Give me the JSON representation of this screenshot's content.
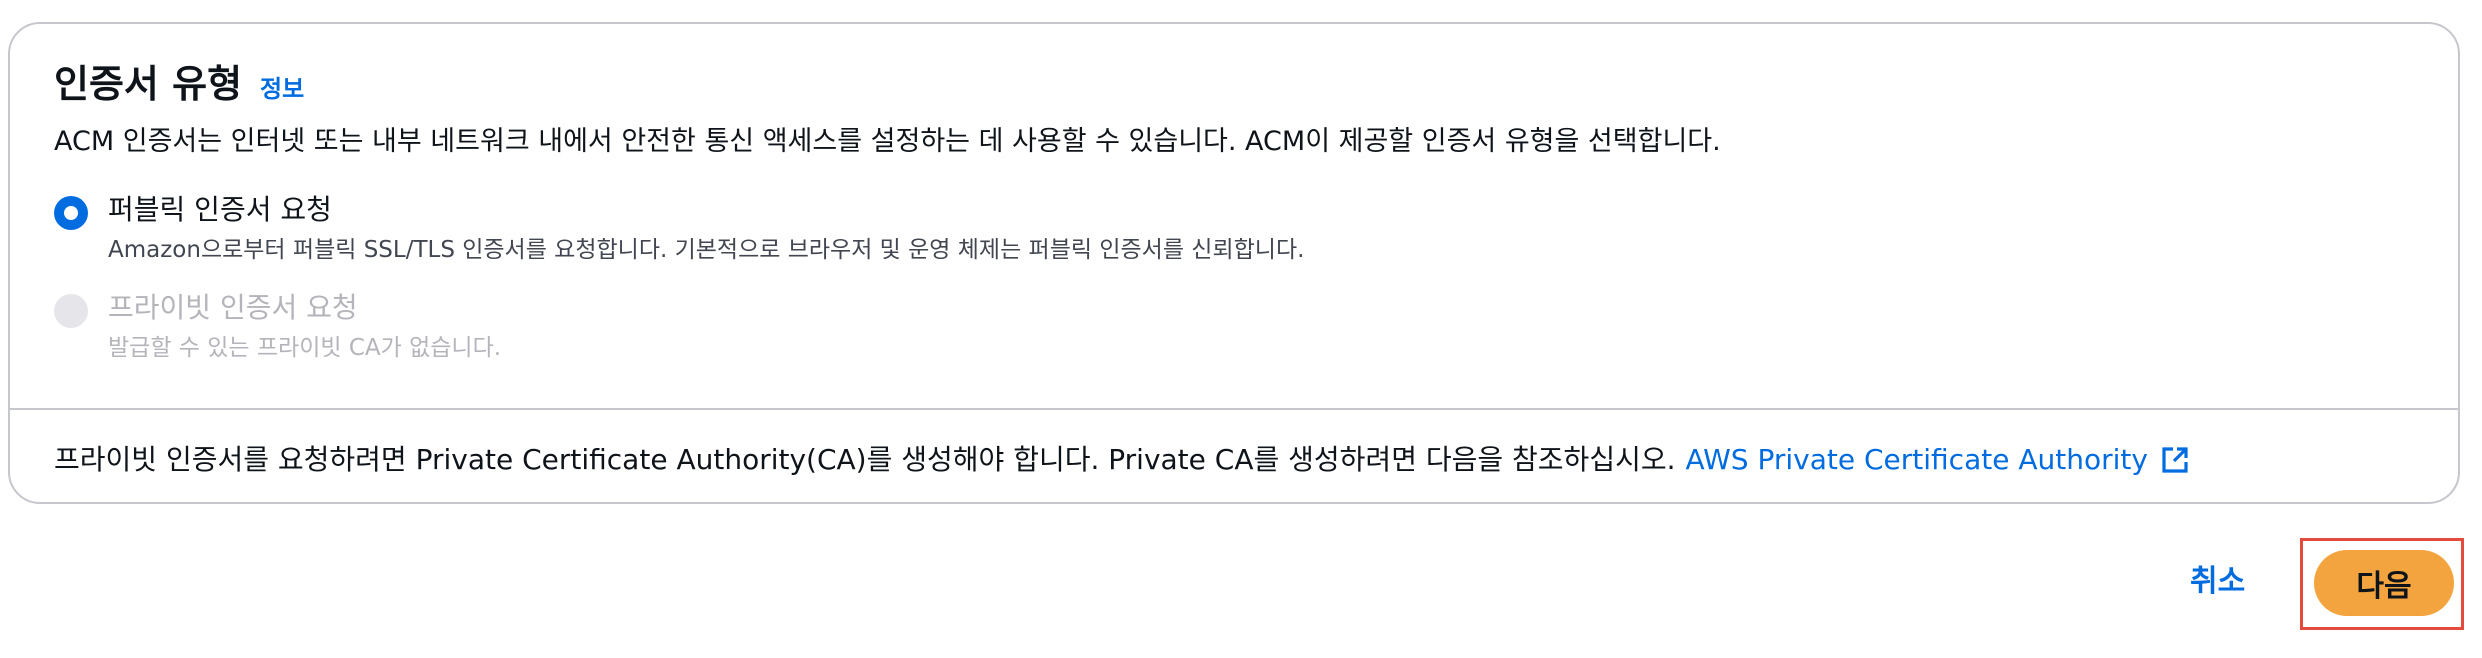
{
  "section": {
    "title": "인증서 유형",
    "info_link": "정보",
    "description": "ACM 인증서는 인터넷 또는 내부 네트워크 내에서 안전한 통신 액세스를 설정하는 데 사용할 수 있습니다. ACM이 제공할 인증서 유형을 선택합니다."
  },
  "options": [
    {
      "label": "퍼블릭 인증서 요청",
      "description": "Amazon으로부터 퍼블릭 SSL/TLS 인증서를 요청합니다. 기본적으로 브라우저 및 운영 체제는 퍼블릭 인증서를 신뢰합니다.",
      "selected": true,
      "disabled": false
    },
    {
      "label": "프라이빗 인증서 요청",
      "description": "발급할 수 있는 프라이빗 CA가 없습니다.",
      "selected": false,
      "disabled": true
    }
  ],
  "footer": {
    "text": "프라이빗 인증서를 요청하려면 Private Certificate Authority(CA)를 생성해야 합니다. Private CA를 생성하려면 다음을 참조하십시오.",
    "link_label": "AWS Private Certificate Authority",
    "link_icon": "external-link-icon"
  },
  "actions": {
    "cancel_label": "취소",
    "next_label": "다음"
  },
  "colors": {
    "accent": "#006ce0",
    "primary_button": "#f4a43e",
    "highlight_border": "#e34b3c",
    "border": "#c6c6cd",
    "disabled_text": "#b4b4bb"
  }
}
